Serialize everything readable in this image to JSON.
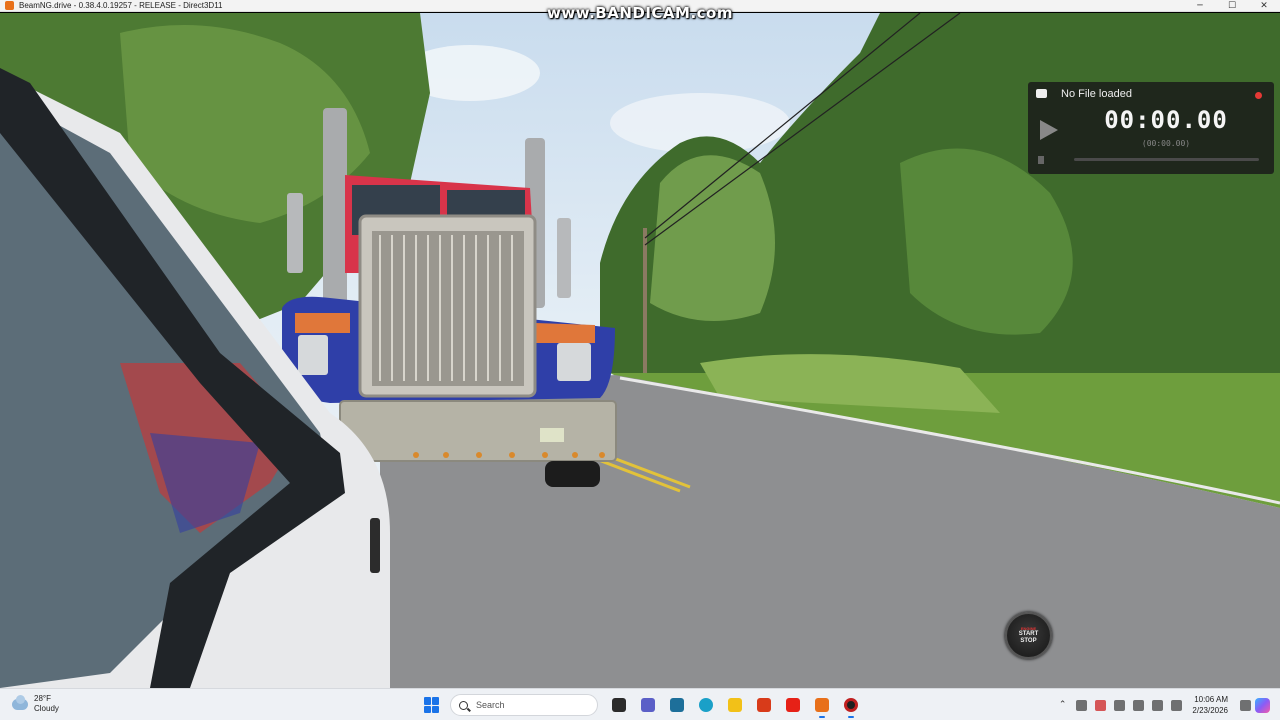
{
  "window": {
    "title": "BeamNG.drive - 0.38.4.0.19257 - RELEASE - Direct3D11",
    "minimize_glyph": "─",
    "maximize_glyph": "☐",
    "close_glyph": "✕"
  },
  "watermark": "www.BANDICAM.com",
  "recorder": {
    "status": "No File loaded",
    "time": "00:00.00",
    "subtime": "(00:00.00)"
  },
  "engine_button": {
    "top": "ENGINE",
    "line1": "START",
    "line2": "STOP"
  },
  "taskbar": {
    "weather_temp": "28°F",
    "weather_desc": "Cloudy",
    "search_label": "Search",
    "tray_chevron": "⌃",
    "time": "10:06 AM",
    "date": "2/23/2026",
    "apps": [
      {
        "name": "task-view-icon",
        "color": "#2b2b2b"
      },
      {
        "name": "chat-icon",
        "color": "#5b5fc7"
      },
      {
        "name": "store-icon",
        "color": "#1d6f9a"
      },
      {
        "name": "edge-icon",
        "color": "#1aa0c8"
      },
      {
        "name": "file-explorer-icon",
        "color": "#f2c118"
      },
      {
        "name": "app-red-icon",
        "color": "#d83b1a"
      },
      {
        "name": "youtube-icon",
        "color": "#e62117"
      },
      {
        "name": "beamng-icon",
        "color": "#e8701a"
      },
      {
        "name": "bandicam-icon",
        "color": "#1f1f1f"
      }
    ]
  },
  "colors": {
    "accent": "#1a73e8",
    "record_dot": "#e53935",
    "truck_red": "#d8344a",
    "truck_blue": "#2f3fa8"
  }
}
